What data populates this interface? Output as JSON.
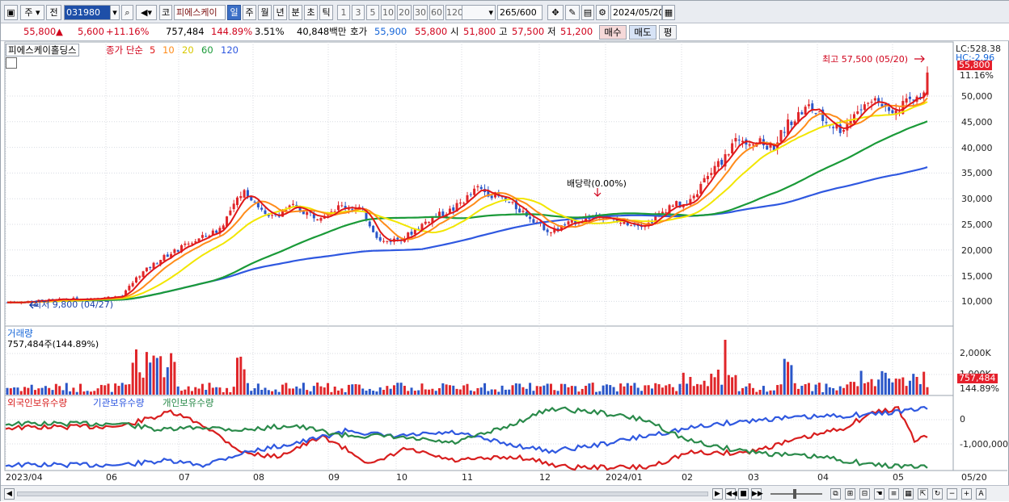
{
  "toolbar": {
    "period1": "주",
    "prev": "전",
    "code": "031980",
    "market": "코",
    "name": "피에스케이",
    "timeframes": [
      "일",
      "주",
      "월",
      "년",
      "분",
      "초",
      "틱"
    ],
    "ticks": [
      "1",
      "3",
      "5",
      "10",
      "20",
      "30",
      "60",
      "120"
    ],
    "count": "265",
    "count_max": "/600",
    "date": "2024/05/20"
  },
  "info": {
    "price": "55,800",
    "change_arrow": "▲",
    "change": "5,600",
    "change_pct": "+11.16%",
    "volume": "757,484",
    "volume_pct": "144.89%",
    "turnover_rate": "3.51%",
    "amount": "40,848백만",
    "quote_label": "호가",
    "ask": "55,900",
    "bid": "55,800",
    "open_label": "시",
    "open": "51,800",
    "high_label": "고",
    "high": "57,500",
    "low_label": "저",
    "low": "51,200",
    "buy": "매수",
    "sell": "매도",
    "eval": "평"
  },
  "legend": {
    "stock": "피에스케이홀딩스",
    "ma_label": "종가 단순",
    "ma": [
      {
        "period": "5",
        "color": "#e01818"
      },
      {
        "period": "10",
        "color": "#ff8c1a"
      },
      {
        "period": "20",
        "color": "#f2e600"
      },
      {
        "period": "60",
        "color": "#1a9a38"
      },
      {
        "period": "120",
        "color": "#2f58e0"
      }
    ]
  },
  "annotations": {
    "high": "최고 57,500 (05/20)",
    "low": "최저 9,800 (04/27)",
    "dividend": "배당락(0.00%)",
    "lc": "LC:528.38",
    "hc": "HC:-2.96",
    "price_tag": "55,800",
    "pct_tag": "11.16%"
  },
  "price_axis": [
    "50,000",
    "45,000",
    "40,000",
    "35,000",
    "30,000",
    "25,000",
    "20,000",
    "15,000",
    "10,000"
  ],
  "volume_panel": {
    "title": "거래량",
    "value": "757,484주(144.89%)",
    "axis": [
      "2,000K",
      "1,000K"
    ],
    "tag": "757,484",
    "tag_pct": "144.89%"
  },
  "holdings_panel": {
    "titles": [
      "외국인보유수량",
      "기관보유수량",
      "개인보유수량"
    ],
    "colors": [
      "#d81e1e",
      "#2f58e0",
      "#2a8a4a"
    ],
    "axis": [
      "0",
      "-1,000,000"
    ]
  },
  "x_axis": [
    "2023/04",
    "06",
    "07",
    "08",
    "09",
    "10",
    "11",
    "12",
    "2024/01",
    "02",
    "03",
    "04",
    "05",
    "05/20"
  ],
  "colors": {
    "up": "#e0262a",
    "down": "#2a56c8",
    "grid": "#d8dbe2"
  },
  "chart_data": {
    "type": "candlestick",
    "y_axis_ticks": [
      10000,
      15000,
      20000,
      25000,
      30000,
      35000,
      40000,
      45000,
      50000
    ],
    "ylim": [
      6000,
      57500
    ],
    "price_keypoints": [
      {
        "t": "2023/04",
        "v": 9800
      },
      {
        "t": "06",
        "v": 11000
      },
      {
        "t": "07",
        "v": 21000
      },
      {
        "t": "07-mid",
        "v": 33000
      },
      {
        "t": "08",
        "v": 26000
      },
      {
        "t": "09",
        "v": 29000
      },
      {
        "t": "10",
        "v": 21000
      },
      {
        "t": "11",
        "v": 33000
      },
      {
        "t": "12",
        "v": 24000
      },
      {
        "t": "2024/01",
        "v": 27000
      },
      {
        "t": "02",
        "v": 28000
      },
      {
        "t": "02-mid",
        "v": 42000
      },
      {
        "t": "03",
        "v": 40000
      },
      {
        "t": "04",
        "v": 46000
      },
      {
        "t": "05",
        "v": 49000
      },
      {
        "t": "05/20",
        "v": 55800
      }
    ],
    "last": {
      "open": 51800,
      "high": 57500,
      "low": 51200,
      "close": 55800
    },
    "volume_axis_ticks": [
      1000000,
      2000000
    ],
    "last_volume": 757484
  }
}
